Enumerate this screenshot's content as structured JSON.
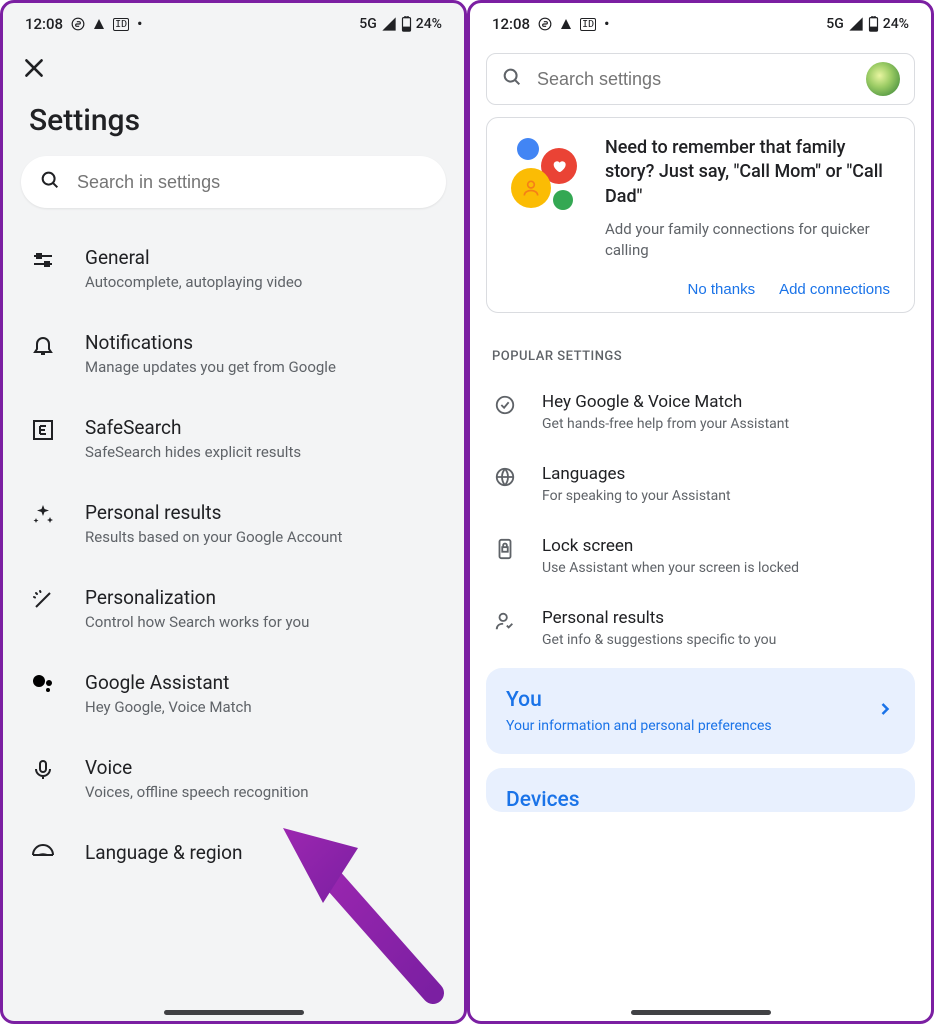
{
  "status": {
    "time": "12:08",
    "network": "5G",
    "battery": "24%"
  },
  "left": {
    "title": "Settings",
    "search_placeholder": "Search in settings",
    "items": [
      {
        "title": "General",
        "sub": "Autocomplete, autoplaying video"
      },
      {
        "title": "Notifications",
        "sub": "Manage updates you get from Google"
      },
      {
        "title": "SafeSearch",
        "sub": "SafeSearch hides explicit results"
      },
      {
        "title": "Personal results",
        "sub": "Results based on your Google Account"
      },
      {
        "title": "Personalization",
        "sub": "Control how Search works for you"
      },
      {
        "title": "Google Assistant",
        "sub": "Hey Google, Voice Match"
      },
      {
        "title": "Voice",
        "sub": "Voices, offline speech recognition"
      },
      {
        "title": "Language & region",
        "sub": ""
      }
    ]
  },
  "right": {
    "search_placeholder": "Search settings",
    "card": {
      "heading": "Need to remember that family story? Just say, \"Call Mom\" or \"Call Dad\"",
      "body": "Add your family connections for quicker calling",
      "no": "No thanks",
      "add": "Add connections"
    },
    "popular_label": "POPULAR SETTINGS",
    "popular": [
      {
        "title": "Hey Google & Voice Match",
        "sub": "Get hands-free help from your Assistant"
      },
      {
        "title": "Languages",
        "sub": "For speaking to your Assistant"
      },
      {
        "title": "Lock screen",
        "sub": "Use Assistant when your screen is locked"
      },
      {
        "title": "Personal results",
        "sub": "Get info & suggestions specific to you"
      }
    ],
    "tiles": {
      "you_title": "You",
      "you_sub": "Your information and personal preferences",
      "devices_title": "Devices"
    }
  }
}
